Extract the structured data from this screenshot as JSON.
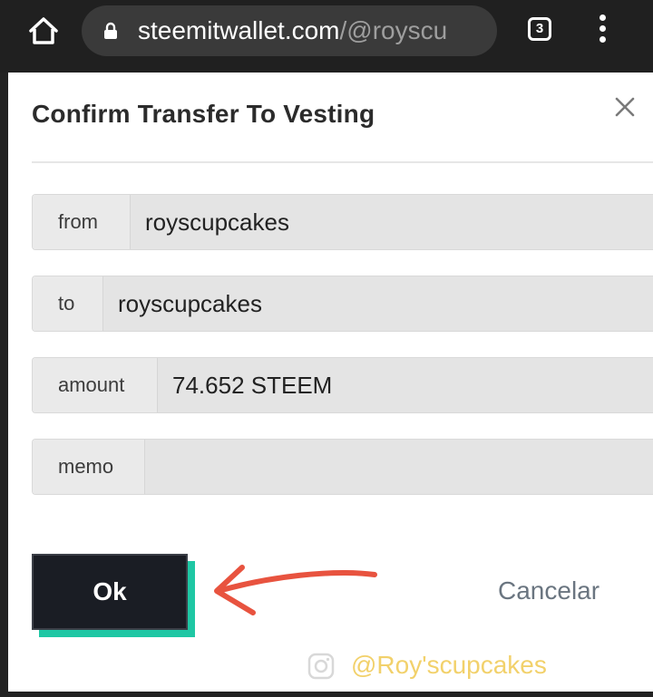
{
  "browser": {
    "url_domain": "steemitwallet.com",
    "url_path": "/@royscu",
    "tab_count": "3",
    "icons": {
      "home": "home-icon",
      "lock": "lock-icon",
      "menu": "more-vert-icon"
    }
  },
  "modal": {
    "title": "Confirm Transfer To Vesting",
    "close_icon": "close-icon",
    "fields": {
      "from": {
        "label": "from",
        "value": "royscupcakes"
      },
      "to": {
        "label": "to",
        "value": "royscupcakes"
      },
      "amount": {
        "label": "amount",
        "value": "74.652 STEEM"
      },
      "memo": {
        "label": "memo",
        "value": ""
      }
    },
    "ok_label": "Ok",
    "cancel_label": "Cancelar"
  },
  "annotation": {
    "arrow_icon": "arrow-left-icon",
    "watermark": "@Roy'scupcakes"
  },
  "colors": {
    "ok_button": "#1a1d24",
    "ok_accent": "#1fc7a4",
    "arrow": "#e8533f",
    "watermark": "#f2d16b"
  }
}
